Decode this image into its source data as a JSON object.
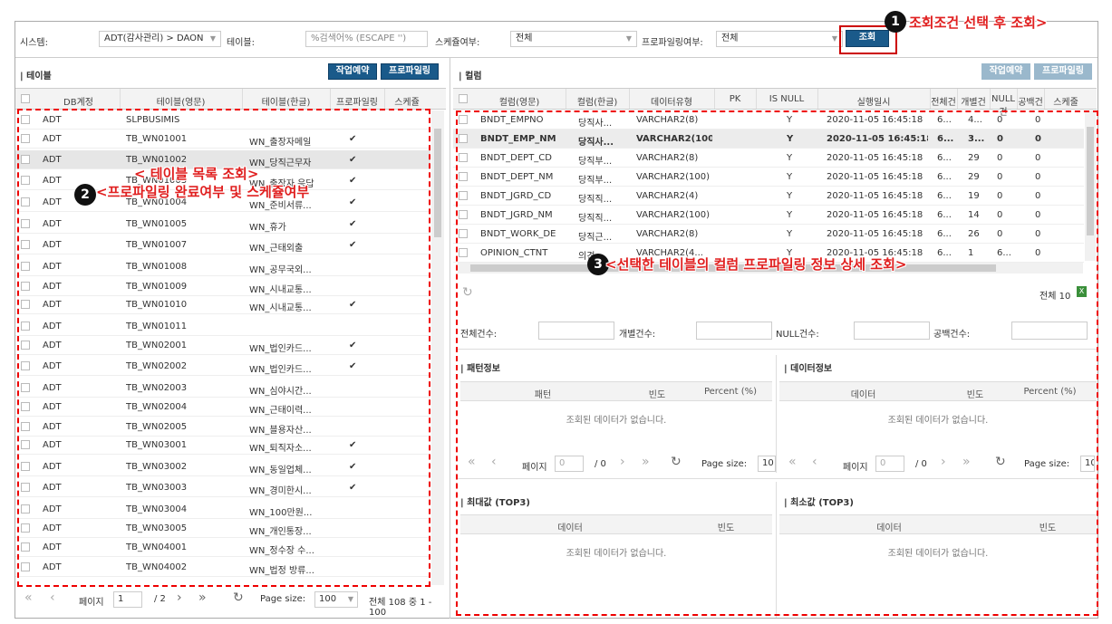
{
  "filters": {
    "system_label": "시스템:",
    "system_value": "ADT(감사관리) > DAON",
    "table_label": "테이블:",
    "table_placeholder": "%검색어% (ESCAPE '')",
    "schedule_label": "스케쥴여부:",
    "schedule_value": "전체",
    "profiling_label": "프로파일링여부:",
    "profiling_value": "전체",
    "search_button": "조회"
  },
  "left": {
    "title": "| 테이블",
    "btn_job": "작업예약",
    "btn_profile": "프로파일링",
    "columns": [
      "DB계정",
      "테이블(영문)",
      "테이블(한글)",
      "프로파일링",
      "스케쥴"
    ],
    "rows": [
      {
        "db": "ADT",
        "en": "SLPBUSIMIS",
        "ko": "",
        "chk": ""
      },
      {
        "db": "ADT",
        "en": "TB_WN01001",
        "ko": "WN_출장자메일",
        "chk": "✔"
      },
      {
        "db": "ADT",
        "en": "TB_WN01002",
        "ko": "WN_당직근무자",
        "chk": "✔"
      },
      {
        "db": "ADT",
        "en": "TB_WN01003",
        "ko": "WN_출장자 응답",
        "chk": "✔"
      },
      {
        "db": "ADT",
        "en": "TB_WN01004",
        "ko": "WN_준비서류...",
        "chk": "✔"
      },
      {
        "db": "ADT",
        "en": "TB_WN01005",
        "ko": "WN_휴가",
        "chk": "✔"
      },
      {
        "db": "ADT",
        "en": "TB_WN01007",
        "ko": "WN_근태외출",
        "chk": "✔"
      },
      {
        "db": "ADT",
        "en": "TB_WN01008",
        "ko": "WN_공무국외...",
        "chk": ""
      },
      {
        "db": "ADT",
        "en": "TB_WN01009",
        "ko": "WN_시내교통...",
        "chk": ""
      },
      {
        "db": "ADT",
        "en": "TB_WN01010",
        "ko": "WN_시내교통...",
        "chk": "✔"
      },
      {
        "db": "ADT",
        "en": "TB_WN01011",
        "ko": "",
        "chk": ""
      },
      {
        "db": "ADT",
        "en": "TB_WN02001",
        "ko": "WN_법인카드...",
        "chk": "✔"
      },
      {
        "db": "ADT",
        "en": "TB_WN02002",
        "ko": "WN_법인카드...",
        "chk": "✔"
      },
      {
        "db": "ADT",
        "en": "TB_WN02003",
        "ko": "WN_심야시간...",
        "chk": ""
      },
      {
        "db": "ADT",
        "en": "TB_WN02004",
        "ko": "WN_근태이력...",
        "chk": ""
      },
      {
        "db": "ADT",
        "en": "TB_WN02005",
        "ko": "WN_블용자산...",
        "chk": ""
      },
      {
        "db": "ADT",
        "en": "TB_WN03001",
        "ko": "WN_퇴직자소...",
        "chk": "✔"
      },
      {
        "db": "ADT",
        "en": "TB_WN03002",
        "ko": "WN_동일업체...",
        "chk": "✔"
      },
      {
        "db": "ADT",
        "en": "TB_WN03003",
        "ko": "WN_경미한시...",
        "chk": "✔"
      },
      {
        "db": "ADT",
        "en": "TB_WN03004",
        "ko": "WN_100만원...",
        "chk": ""
      },
      {
        "db": "ADT",
        "en": "TB_WN03005",
        "ko": "WN_개인통장...",
        "chk": ""
      },
      {
        "db": "ADT",
        "en": "TB_WN04001",
        "ko": "WN_정수장 수...",
        "chk": ""
      },
      {
        "db": "ADT",
        "en": "TB_WN04002",
        "ko": "WN_법정 방류...",
        "chk": ""
      }
    ],
    "pager": {
      "page_label": "페이지",
      "page": "1",
      "total_pages": "/ 2",
      "size_label": "Page size:",
      "size": "100",
      "summary": "전체 108 중 1 - 100"
    }
  },
  "right": {
    "title": "| 컬럼",
    "btn_job": "작업예약",
    "btn_profile": "프로파일링",
    "columns": [
      "컬럼(영문)",
      "컬럼(한글)",
      "데이터유형",
      "PK",
      "IS NULL",
      "실행일시",
      "전체건",
      "개별건",
      "NULL건",
      "공백건",
      "스케줄"
    ],
    "rows": [
      {
        "en": "BNDT_EMPNO",
        "ko": "당직사...",
        "type": "VARCHAR2(8)",
        "pk": "",
        "isnull": "Y",
        "dt": "2020-11-05 16:45:18",
        "tot": "6...",
        "ind": "4...",
        "nul": "0",
        "blank": "0",
        "bold": false
      },
      {
        "en": "BNDT_EMP_NM",
        "ko": "당직사...",
        "type": "VARCHAR2(100)",
        "pk": "",
        "isnull": "Y",
        "dt": "2020-11-05 16:45:18",
        "tot": "6...",
        "ind": "3...",
        "nul": "0",
        "blank": "0",
        "bold": true
      },
      {
        "en": "BNDT_DEPT_CD",
        "ko": "당직부...",
        "type": "VARCHAR2(8)",
        "pk": "",
        "isnull": "Y",
        "dt": "2020-11-05 16:45:18",
        "tot": "6...",
        "ind": "29",
        "nul": "0",
        "blank": "0",
        "bold": false
      },
      {
        "en": "BNDT_DEPT_NM",
        "ko": "당직부...",
        "type": "VARCHAR2(100)",
        "pk": "",
        "isnull": "Y",
        "dt": "2020-11-05 16:45:18",
        "tot": "6...",
        "ind": "29",
        "nul": "0",
        "blank": "0",
        "bold": false
      },
      {
        "en": "BNDT_JGRD_CD",
        "ko": "당직직...",
        "type": "VARCHAR2(4)",
        "pk": "",
        "isnull": "Y",
        "dt": "2020-11-05 16:45:18",
        "tot": "6...",
        "ind": "19",
        "nul": "0",
        "blank": "0",
        "bold": false
      },
      {
        "en": "BNDT_JGRD_NM",
        "ko": "당직직...",
        "type": "VARCHAR2(100)",
        "pk": "",
        "isnull": "Y",
        "dt": "2020-11-05 16:45:18",
        "tot": "6...",
        "ind": "14",
        "nul": "0",
        "blank": "0",
        "bold": false
      },
      {
        "en": "BNDT_WORK_DE",
        "ko": "당직근...",
        "type": "VARCHAR2(8)",
        "pk": "",
        "isnull": "Y",
        "dt": "2020-11-05 16:45:18",
        "tot": "6...",
        "ind": "26",
        "nul": "0",
        "blank": "0",
        "bold": false
      },
      {
        "en": "OPINION_CTNT",
        "ko": "의견",
        "type": "VARCHAR2(4...",
        "pk": "",
        "isnull": "Y",
        "dt": "2020-11-05 16:45:18",
        "tot": "6...",
        "ind": "1",
        "nul": "6...",
        "blank": "0",
        "bold": false
      }
    ],
    "total_text": "전체 10",
    "stats": {
      "total": "전체건수:",
      "individual": "개별건수:",
      "null": "NULL건수:",
      "blank": "공백건수:"
    },
    "pattern": {
      "title": "| 패턴정보",
      "cols": [
        "패턴",
        "빈도",
        "Percent (%)"
      ],
      "empty": "조회된 데이터가 없습니다."
    },
    "datainfo": {
      "title": "| 데이터정보",
      "cols": [
        "데이터",
        "빈도",
        "Percent (%)"
      ],
      "empty": "조회된 데이터가 없습니다."
    },
    "pager_a": {
      "page_label": "페이지",
      "page": "0",
      "total": "/ 0",
      "size_label": "Page size:",
      "size": "10"
    },
    "pager_b": {
      "page_label": "페이지",
      "page": "0",
      "total": "/ 0",
      "size_label": "Page size:",
      "size": "10"
    },
    "max": {
      "title": "| 최대값 (TOP3)",
      "cols": [
        "데이터",
        "빈도"
      ],
      "empty": "조회된 데이터가 없습니다."
    },
    "min": {
      "title": "| 최소값 (TOP3)",
      "cols": [
        "데이터",
        "빈도"
      ],
      "empty": "조회된 데이터가 없습니다."
    }
  },
  "annotations": {
    "n1": "1",
    "t1": "조회조건 선택 후 조회>",
    "n2": "2",
    "t2a": "< 테이블 목록 조회>",
    "t2b": "<프로파일링 완료여부 및 스케쥴여부",
    "n3": "3",
    "t3": "<선택한 테이블의 컬럼 프로파일링 정보 상세 조회>"
  },
  "colors": {
    "primary": "#1a5a8a",
    "disabled": "#9ab8cc",
    "annotation": "#e02020"
  }
}
